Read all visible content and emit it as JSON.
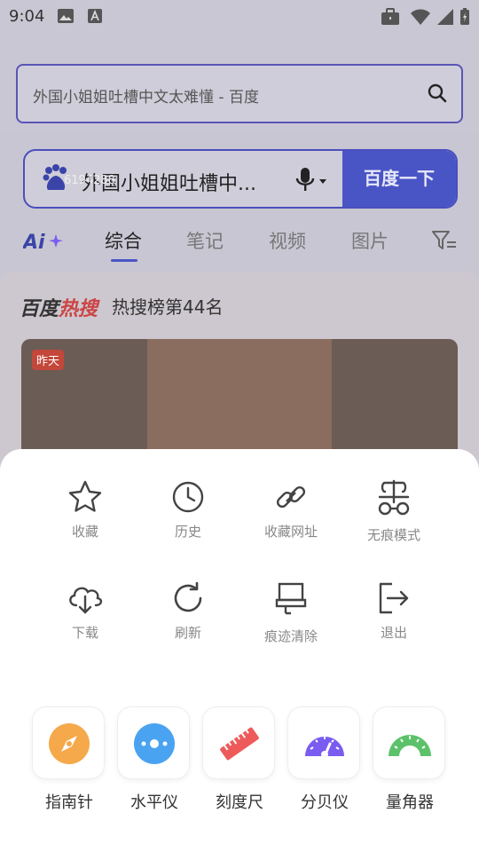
{
  "status_bar": {
    "time": "9:04"
  },
  "address_bar": {
    "url_text": "外国小姐姐吐槽中文太难懂 - 百度"
  },
  "search": {
    "query": "外国小姐姐吐槽中...",
    "overlay_number": "6194288",
    "button_label": "百度一下"
  },
  "tabs": [
    {
      "label": "综合"
    },
    {
      "label": "笔记"
    },
    {
      "label": "视频"
    },
    {
      "label": "图片"
    }
  ],
  "hot": {
    "logo_part1": "百度",
    "logo_part2": "热搜",
    "rank_text": "热搜榜第44名",
    "badge": "昨天"
  },
  "menu": {
    "items": [
      {
        "label": "收藏",
        "icon": "star-icon"
      },
      {
        "label": "历史",
        "icon": "clock-icon"
      },
      {
        "label": "收藏网址",
        "icon": "link-icon"
      },
      {
        "label": "无痕模式",
        "icon": "incognito-icon"
      },
      {
        "label": "下载",
        "icon": "cloud-download-icon"
      },
      {
        "label": "刷新",
        "icon": "refresh-icon"
      },
      {
        "label": "痕迹清除",
        "icon": "eraser-icon"
      },
      {
        "label": "退出",
        "icon": "exit-icon"
      }
    ]
  },
  "tools": [
    {
      "label": "指南针",
      "icon": "compass-icon",
      "color": "#f5a94a"
    },
    {
      "label": "水平仪",
      "icon": "level-icon",
      "color": "#4aa3f0"
    },
    {
      "label": "刻度尺",
      "icon": "ruler-icon",
      "color": "#ee5a5a"
    },
    {
      "label": "分贝仪",
      "icon": "decibel-meter-icon",
      "color": "#7a5cf0"
    },
    {
      "label": "量角器",
      "icon": "protractor-icon",
      "color": "#5cc26a"
    }
  ],
  "colors": {
    "accent": "#4a55c5",
    "menu_icon": "#444444",
    "label_gray": "#888888"
  }
}
